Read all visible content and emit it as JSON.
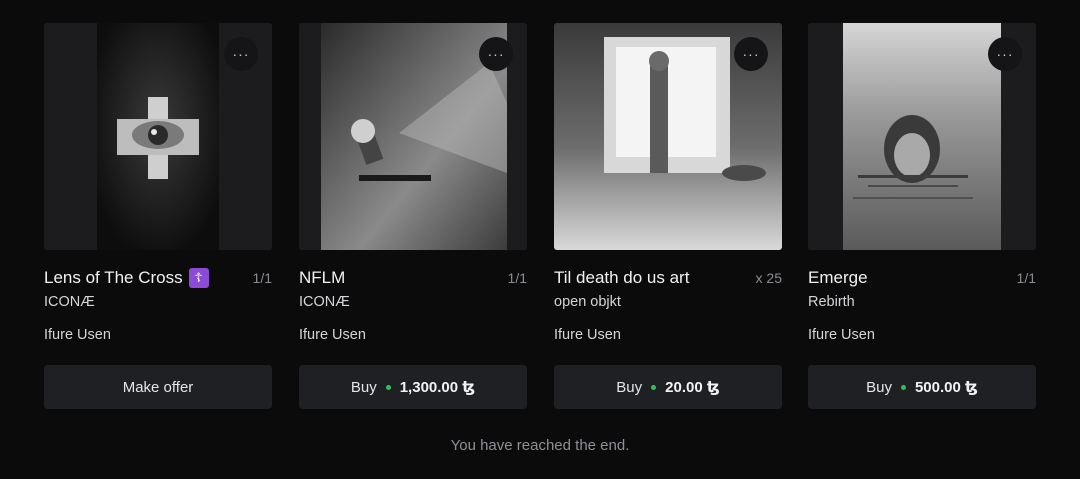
{
  "cards": [
    {
      "title": "Lens of The Cross",
      "badge_icon": "orthodox-cross-emoji",
      "badge_glyph": "☦",
      "edition": "1/1",
      "collection": "ICONÆ",
      "artist": "Ifure Usen",
      "action_label": "Make offer",
      "more_label": "···"
    },
    {
      "title": "NFLM",
      "edition": "1/1",
      "collection": "ICONÆ",
      "artist": "Ifure Usen",
      "action_label": "Buy",
      "price": "1,300.00 ꜩ",
      "more_label": "···"
    },
    {
      "title": "Til death do us art",
      "edition": "x 25",
      "collection": "open objkt",
      "artist": "Ifure Usen",
      "action_label": "Buy",
      "price": "20.00 ꜩ",
      "more_label": "···"
    },
    {
      "title": "Emerge",
      "edition": "1/1",
      "collection": "Rebirth",
      "artist": "Ifure Usen",
      "action_label": "Buy",
      "price": "500.00 ꜩ",
      "more_label": "···"
    }
  ],
  "footer": {
    "end_text": "You have reached the end."
  },
  "colors": {
    "background": "#0b0b0c",
    "button": "#1f2023",
    "price_dot": "#2fbf5a"
  }
}
